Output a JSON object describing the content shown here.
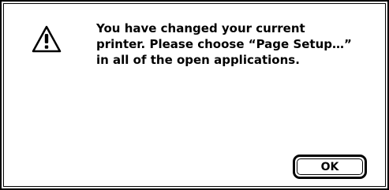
{
  "dialog": {
    "icon": "warning-triangle-icon",
    "message_lines": [
      "You have changed your current",
      "printer. Please choose “Page Setup…”",
      "in all of the open applications."
    ],
    "ok_label": "OK"
  }
}
